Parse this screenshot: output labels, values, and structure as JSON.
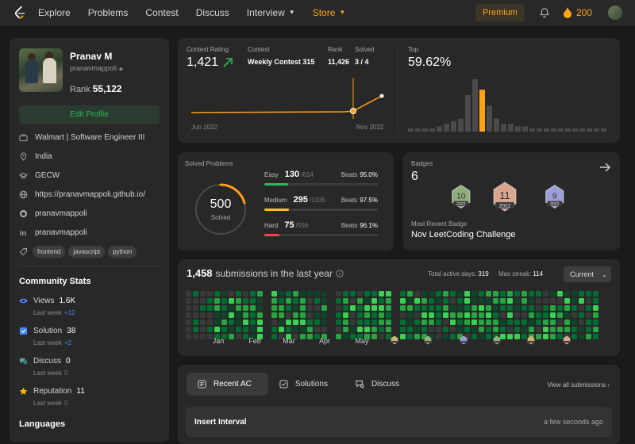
{
  "nav": {
    "items": [
      "Explore",
      "Problems",
      "Contest",
      "Discuss",
      "Interview",
      "Store"
    ],
    "premium": "Premium",
    "streak": "200"
  },
  "profile": {
    "name": "Pranav M",
    "username": "pranavmappoli",
    "rank_label": "Rank",
    "rank": "55,122",
    "edit_label": "Edit Profile",
    "company": "Walmart | Software Engineer III",
    "country": "India",
    "school": "GECW",
    "website": "https://pranavmappoli.github.io/",
    "github": "pranavmappoli",
    "linkedin": "pranavmappoli",
    "tags": [
      "frontend",
      "javascript",
      "python"
    ]
  },
  "community": {
    "title": "Community Stats",
    "views": {
      "label": "Views",
      "value": "1.6K",
      "sub": "Last week",
      "delta": "+12"
    },
    "solution": {
      "label": "Solution",
      "value": "38",
      "sub": "Last week",
      "delta": "+2"
    },
    "discuss": {
      "label": "Discuss",
      "value": "0",
      "sub": "Last week",
      "delta": "0"
    },
    "reputation": {
      "label": "Reputation",
      "value": "11",
      "sub": "Last week",
      "delta": "0"
    },
    "languages_title": "Languages"
  },
  "contest": {
    "rating_label": "Contest Rating",
    "rating": "1,421",
    "contest_label": "Contest",
    "contest_name": "Weekly Contest 315",
    "rank_label": "Rank",
    "rank": "11,426",
    "solved_label": "Solved",
    "solved": "3 / 4",
    "top_label": "Top",
    "top": "59.62%",
    "x_start": "Jun 2022",
    "x_end": "Nov 2022",
    "accent": "#ffa116"
  },
  "chart_data": {
    "type": "bar",
    "title": "",
    "values": [
      1,
      1,
      1,
      1,
      2,
      3,
      4,
      5,
      14,
      20,
      16,
      10,
      5,
      3,
      3,
      2,
      2,
      1,
      1,
      1,
      1,
      1,
      1,
      1,
      1,
      1,
      1,
      1
    ],
    "highlight_index": 10,
    "highlight_color": "#ffa116",
    "bar_color": "#4a4a4a"
  },
  "solved": {
    "title": "Solved Problems",
    "total": "500",
    "total_label": "Solved",
    "easy": {
      "label": "Easy",
      "count": "130",
      "total": "/614",
      "beats_label": "Beats",
      "beats": "95.0%",
      "fraction": 0.21,
      "color": "#2cbb5d"
    },
    "medium": {
      "label": "Medium",
      "count": "295",
      "total": "/1335",
      "beats_label": "Beats",
      "beats": "97.5%",
      "fraction": 0.22,
      "color": "#ffc01e"
    },
    "hard": {
      "label": "Hard",
      "count": "75",
      "total": "/556",
      "beats_label": "Beats",
      "beats": "96.1%",
      "fraction": 0.13,
      "color": "#ef4743"
    }
  },
  "badges": {
    "title": "Badges",
    "count": "6",
    "recent_label": "Most Recent Badge",
    "recent_name": "Nov LeetCoding Challenge",
    "items": [
      {
        "num": "10",
        "year": "2022",
        "color": "#8fae7a"
      },
      {
        "num": "11",
        "year": "2022",
        "color": "#d9a58d"
      },
      {
        "num": "9",
        "year": "2022",
        "color": "#9c9ed8"
      }
    ]
  },
  "heatmap": {
    "count": "1,458",
    "title": "submissions in the last year",
    "active_label": "Total active days:",
    "active": "319",
    "streak_label": "Max streak:",
    "streak": "114",
    "dropdown": "Current",
    "months": [
      "Jan",
      "Feb",
      "Mar",
      "Apr",
      "May"
    ]
  },
  "tabs": {
    "items": [
      "Recent AC",
      "Solutions",
      "Discuss"
    ],
    "view_all": "View all submissions",
    "row_title": "Insert Interval",
    "row_time": "a few seconds ago"
  }
}
